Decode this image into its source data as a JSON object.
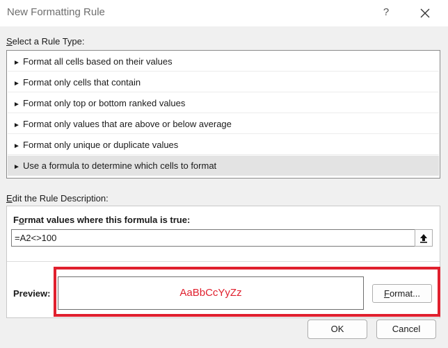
{
  "window": {
    "title": "New Formatting Rule",
    "help_label": "?"
  },
  "rule_type": {
    "label": "Select a Rule Type:",
    "items": [
      "Format all cells based on their values",
      "Format only cells that contain",
      "Format only top or bottom ranked values",
      "Format only values that are above or below average",
      "Format only unique or duplicate values",
      "Use a formula to determine which cells to format"
    ],
    "selected_index": 5
  },
  "description": {
    "label": "Edit the Rule Description:",
    "formula_heading": "Format values where this formula is true:",
    "formula_value": "=A2<>100",
    "preview_label": "Preview:",
    "preview_text": "AaBbCcYyZz",
    "preview_color": "#e0202e",
    "format_button": "Format..."
  },
  "buttons": {
    "ok": "OK",
    "cancel": "Cancel"
  },
  "annotation": {
    "highlight_color": "#e0202e"
  }
}
